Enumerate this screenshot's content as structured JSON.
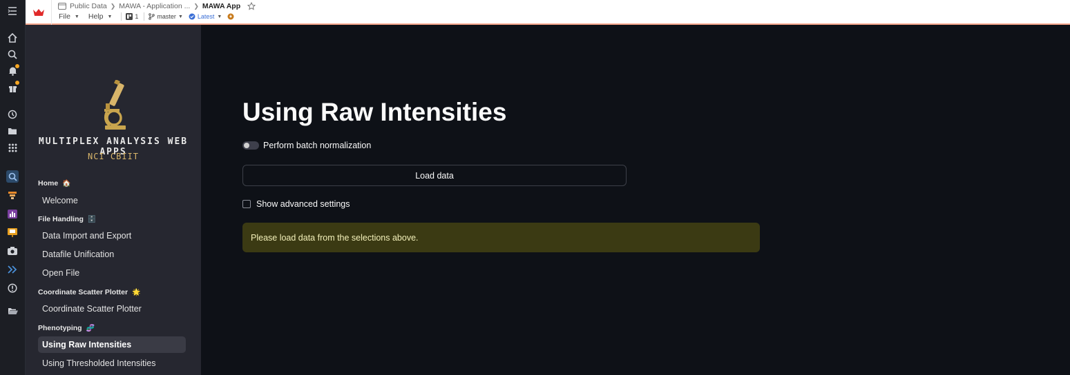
{
  "topbar": {
    "breadcrumb": [
      "Public Data",
      "MAWA - Application ...",
      "MAWA App"
    ],
    "menus": [
      "File",
      "Help"
    ],
    "fork_count": "1",
    "branch": "master",
    "version": "Latest"
  },
  "rail": {
    "icons": [
      "menu-icon",
      "home-icon",
      "search-icon",
      "bell-icon",
      "gift-icon",
      "history-icon",
      "folder-icon",
      "apps-grid-icon",
      "zoom-tool-icon",
      "filter-tool-icon",
      "chart-tool-icon",
      "slideshow-tool-icon",
      "camera-tool-icon",
      "chevrons-tool-icon",
      "alert-circle-icon",
      "open-folder-icon"
    ]
  },
  "sidebar": {
    "brand_title": "MULTIPLEX ANALYSIS WEB APPS",
    "brand_subtitle": "NCI CBIIT",
    "sections": [
      {
        "label": "Home",
        "emoji": "🏠"
      },
      {
        "label": "File Handling",
        "emoji": "🗄️"
      },
      {
        "label": "Coordinate Scatter Plotter",
        "emoji": "🌟"
      },
      {
        "label": "Phenotyping",
        "emoji": "🧬"
      }
    ],
    "items": [
      "Welcome",
      "Data Import and Export",
      "Datafile Unification",
      "Open File",
      "Coordinate Scatter Plotter",
      "Using Raw Intensities",
      "Using Thresholded Intensities"
    ]
  },
  "main": {
    "title": "Using Raw Intensities",
    "toggle_label": "Perform batch normalization",
    "load_button": "Load data",
    "advanced_label": "Show advanced settings",
    "warning": "Please load data from the selections above."
  },
  "colors": {
    "background": "#0e1117",
    "sidebar": "#262730",
    "warning_bg": "#3b3a13",
    "warning_text": "#f3f0b9",
    "brand_gold": "#d8b56a"
  }
}
